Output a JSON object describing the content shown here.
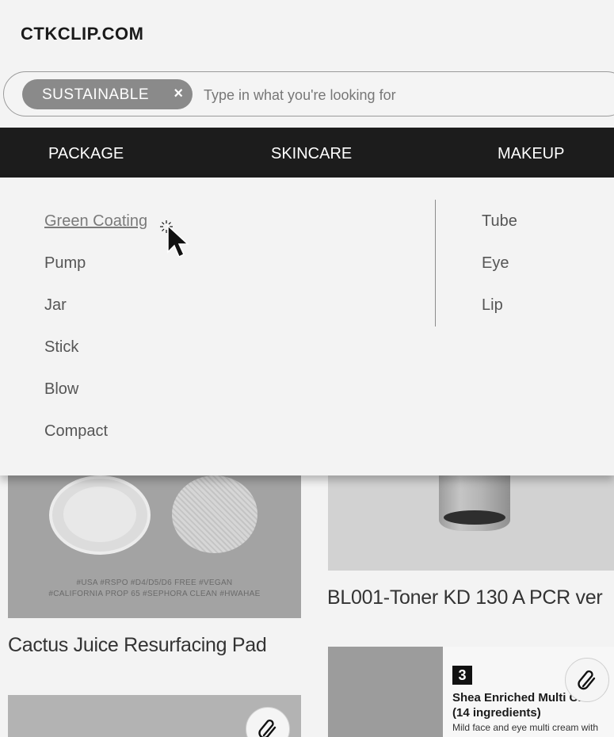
{
  "site": {
    "logo": "CTKCLIP.COM"
  },
  "search": {
    "chip_label": "SUSTAINABLE",
    "chip_close": "×",
    "placeholder": "Type in what you're looking for"
  },
  "nav": {
    "tabs": [
      {
        "label": "PACKAGE"
      },
      {
        "label": "SKINCARE"
      },
      {
        "label": "MAKEUP"
      }
    ]
  },
  "dropdown": {
    "left_column": [
      {
        "label": "Green Coating",
        "hovered": true
      },
      {
        "label": "Pump"
      },
      {
        "label": "Jar"
      },
      {
        "label": "Stick"
      },
      {
        "label": "Blow"
      },
      {
        "label": "Compact"
      }
    ],
    "right_column": [
      {
        "label": "Tube"
      },
      {
        "label": "Eye"
      },
      {
        "label": "Lip"
      }
    ]
  },
  "products": [
    {
      "title": "Cactus Juice Resurfacing Pad",
      "image_tags_line1": "#USA #RSPO #D4/D5/D6 FREE #VEGAN",
      "image_tags_line2": "#CALIFORNIA PROP 65 #SEPHORA CLEAN #HWAHAE"
    },
    {
      "title": "BL001-Toner KD 130 A PCR ver"
    },
    {
      "badge": "3",
      "image_title_line1": "Shea Enriched Multi Cre",
      "image_title_line2": "(14 ingredients)",
      "image_desc": "Mild face and eye multi cream with"
    }
  ],
  "icons": {
    "clip": "paperclip-icon",
    "cursor": "arrow-cursor-icon"
  },
  "colors": {
    "navbar_bg": "#1c1c1c",
    "chip_bg": "#8a8a8a",
    "page_bg": "#f3f3f3"
  }
}
